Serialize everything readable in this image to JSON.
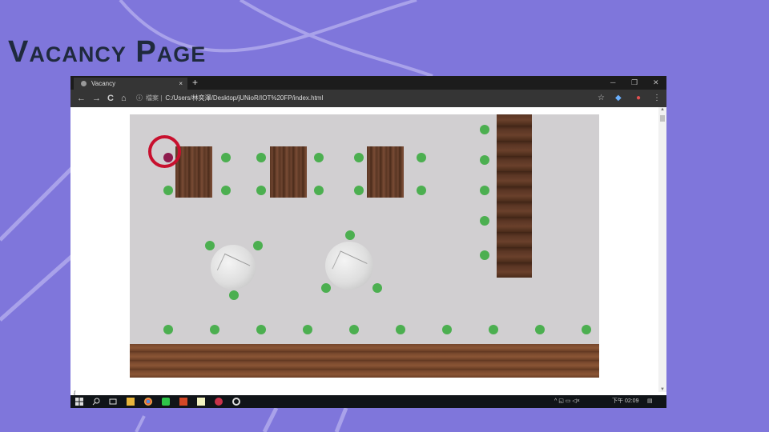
{
  "slide": {
    "title": "Vacancy Page"
  },
  "browser": {
    "tab_title": "Vacancy",
    "tab_close": "×",
    "new_tab": "+",
    "minimize": "─",
    "restore": "❐",
    "close": "✕",
    "nav_back": "←",
    "nav_forward": "→",
    "nav_reload": "C",
    "nav_home": "⌂",
    "url_info": "ⓘ",
    "url_scheme": "檔案 |",
    "url": "C:/Users/林奕澤/Desktop/jUNioR/IOT%20FP/index.html",
    "bookmark_star": "☆",
    "menu": "⋮",
    "status_text": "{"
  },
  "floor_plan": {
    "seats_total": 33,
    "seats_taken": 1,
    "taken_color": "#8e1c4e",
    "free_color": "#4caf50",
    "highlight_color": "#c8102e"
  },
  "taskbar": {
    "clock": "下午 02:09",
    "tray_icons": "^ ◱ ▭ ◁×"
  }
}
